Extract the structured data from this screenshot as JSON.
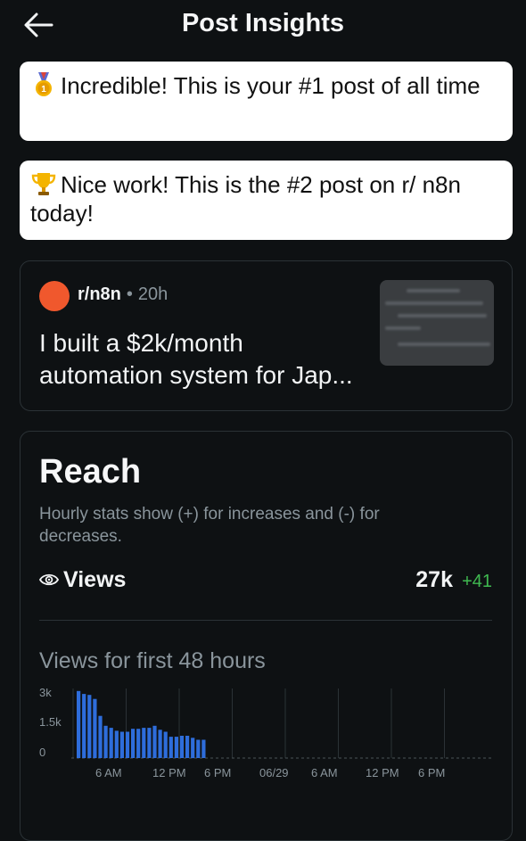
{
  "header": {
    "title": "Post Insights",
    "back_icon": "arrow-left-icon"
  },
  "banners": [
    {
      "icon": "first-place-medal-icon",
      "text": "Incredible! This is your #1 post of all time"
    },
    {
      "icon": "trophy-icon",
      "text": "Nice work! This is the #2 post on r/ n8n today!"
    }
  ],
  "post": {
    "subreddit": "r/n8n",
    "separator": "•",
    "age": "20h",
    "title": "I built a $2k/month automation system for Jap...",
    "avatar_color": "#f0582d"
  },
  "reach": {
    "title": "Reach",
    "subtitle": "Hourly stats show (+) for increases and (-) for decreases.",
    "views_label": "Views",
    "views_icon": "eye-icon",
    "views_value": "27k",
    "views_delta": "+41",
    "chart_title": "Views for first 48 hours"
  },
  "chart_data": {
    "type": "bar",
    "title": "Views for first 48 hours",
    "y_ticks": [
      "3k",
      "1.5k",
      "0"
    ],
    "ylim": [
      0,
      3000
    ],
    "x_ticks": [
      "6 AM",
      "12 PM",
      "6 PM",
      "06/29",
      "6 AM",
      "12 PM",
      "6 PM"
    ],
    "values": [
      3100,
      2950,
      2900,
      2700,
      1850,
      1350,
      1250,
      1100,
      1050,
      1050,
      1200,
      1200,
      1250,
      1250,
      1350,
      1150,
      1050,
      800,
      800,
      850,
      850,
      750,
      650,
      650
    ],
    "bar_color": "#2e6ddb",
    "grid": true
  },
  "colors": {
    "background": "#0e1113",
    "accent_green": "#3fb950",
    "muted": "#8a959c"
  }
}
